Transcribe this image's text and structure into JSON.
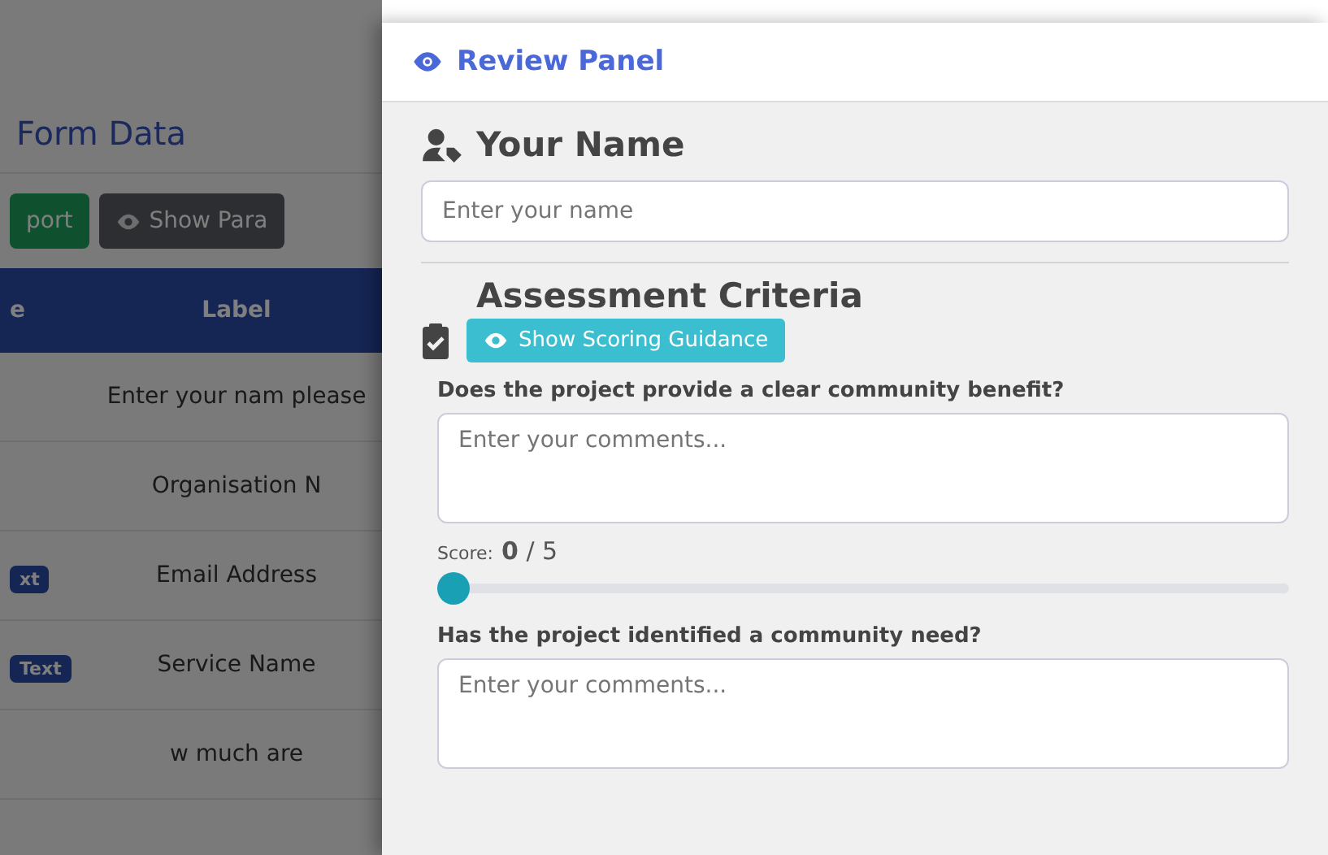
{
  "background_page": {
    "title": "Form Data",
    "buttons": [
      {
        "kind": "success",
        "label": "port"
      },
      {
        "kind": "secondary",
        "label": "Show Para"
      }
    ],
    "table": {
      "columns": [
        "e",
        "Label"
      ],
      "rows": [
        {
          "label": "Enter your nam please"
        },
        {
          "label": "Organisation N"
        },
        {
          "type_badge": "xt",
          "label": "Email Address"
        },
        {
          "type_badge": "Text",
          "label": "Service Name"
        },
        {
          "label": "w much are"
        }
      ]
    }
  },
  "review_panel": {
    "title": "Review Panel",
    "name_section": {
      "heading": "Your Name",
      "placeholder": "Enter your name"
    },
    "assessment": {
      "heading": "Assessment Criteria",
      "guidance_button": "Show Scoring Guidance",
      "criteria": [
        {
          "question": "Does the project provide a clear community benefit?",
          "placeholder": "Enter your comments...",
          "score_label": "Score:",
          "score": "**0** / 5",
          "level": 0
        },
        {
          "question": "Has the project identified a community need?",
          "placeholder": "Enter your comments..."
        }
      ]
    }
  }
}
